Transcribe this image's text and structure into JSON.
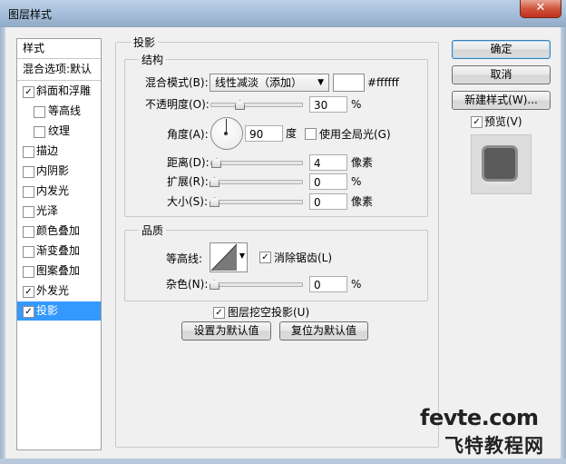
{
  "window": {
    "title": "图层样式",
    "close": "✕"
  },
  "sidebar": {
    "header": "样式",
    "blend": "混合选项:默认",
    "items": [
      {
        "label": "斜面和浮雕",
        "checked": true,
        "indent": false
      },
      {
        "label": "等高线",
        "checked": false,
        "indent": true
      },
      {
        "label": "纹理",
        "checked": false,
        "indent": true
      },
      {
        "label": "描边",
        "checked": false,
        "indent": false
      },
      {
        "label": "内阴影",
        "checked": false,
        "indent": false
      },
      {
        "label": "内发光",
        "checked": false,
        "indent": false
      },
      {
        "label": "光泽",
        "checked": false,
        "indent": false
      },
      {
        "label": "颜色叠加",
        "checked": false,
        "indent": false
      },
      {
        "label": "渐变叠加",
        "checked": false,
        "indent": false
      },
      {
        "label": "图案叠加",
        "checked": false,
        "indent": false
      },
      {
        "label": "外发光",
        "checked": true,
        "indent": false
      },
      {
        "label": "投影",
        "checked": true,
        "indent": false,
        "selected": true
      }
    ]
  },
  "panel": {
    "section": "投影",
    "structure": {
      "title": "结构",
      "blend_mode_label": "混合模式(B):",
      "blend_mode_value": "线性减淡（添加）",
      "color_hex": "#ffffff",
      "opacity_label": "不透明度(O):",
      "opacity_value": "30",
      "opacity_unit": "%",
      "opacity_level": 0.3,
      "angle_label": "角度(A):",
      "angle_value": "90",
      "angle_unit": "度",
      "global_light_label": "使用全局光(G)",
      "global_light_checked": false,
      "distance_label": "距离(D):",
      "distance_value": "4",
      "distance_unit": "像素",
      "spread_label": "扩展(R):",
      "spread_value": "0",
      "spread_unit": "%",
      "size_label": "大小(S):",
      "size_value": "0",
      "size_unit": "像素"
    },
    "quality": {
      "title": "品质",
      "contour_label": "等高线:",
      "antialias_label": "消除锯齿(L)",
      "antialias_checked": true,
      "noise_label": "杂色(N):",
      "noise_value": "0",
      "noise_unit": "%"
    },
    "knockout_label": "图层挖空投影(U)",
    "knockout_checked": true,
    "set_default": "设置为默认值",
    "reset_default": "复位为默认值"
  },
  "buttons": {
    "ok": "确定",
    "cancel": "取消",
    "new_style": "新建样式(W)...",
    "preview_label": "预览(V)",
    "preview_checked": true
  },
  "watermark": {
    "line1": "fevte.com",
    "line2": "飞特教程网"
  },
  "colors": {
    "selection": "#3399ff",
    "default_button_border": "#3c7fb1"
  }
}
